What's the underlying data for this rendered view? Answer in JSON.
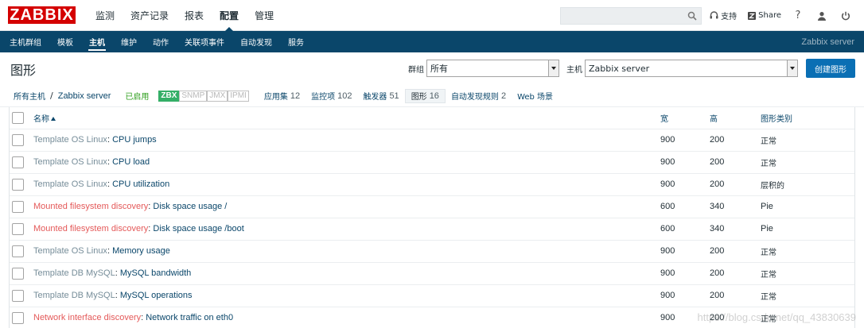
{
  "logo": "ZABBIX",
  "main_menu": [
    "监测",
    "资产记录",
    "报表",
    "配置",
    "管理"
  ],
  "main_menu_active": 3,
  "top_right": {
    "search_placeholder": "",
    "support_label": "支持",
    "share_label": "Share",
    "help_icon": "?",
    "user_icon": "user-icon",
    "logout_icon": "power-icon"
  },
  "sub_menu": [
    "主机群组",
    "模板",
    "主机",
    "维护",
    "动作",
    "关联项事件",
    "自动发现",
    "服务"
  ],
  "sub_menu_active": 2,
  "server_name": "Zabbix server",
  "page_title": "图形",
  "filter": {
    "group_label": "群组",
    "group_value": "所有",
    "host_label": "主机",
    "host_value": "Zabbix server",
    "create_button": "创建图形"
  },
  "breadcrumb": {
    "all_hosts": "所有主机",
    "separator": "/",
    "host": "Zabbix server",
    "enabled": "已启用"
  },
  "availability": [
    "ZBX",
    "SNMP",
    "JMX",
    "IPMI"
  ],
  "tabs": [
    {
      "label": "应用集",
      "count": "12"
    },
    {
      "label": "监控项",
      "count": "102"
    },
    {
      "label": "触发器",
      "count": "51"
    },
    {
      "label": "图形",
      "count": "16"
    },
    {
      "label": "自动发现规则",
      "count": "2"
    },
    {
      "label": "Web 场景",
      "count": ""
    }
  ],
  "tab_active": 3,
  "columns": {
    "name": "名称",
    "width": "宽",
    "height": "高",
    "type": "图形类别"
  },
  "rows": [
    {
      "host": "Template OS Linux",
      "discovery": false,
      "name": "CPU jumps",
      "width": "900",
      "height": "200",
      "type": "正常"
    },
    {
      "host": "Template OS Linux",
      "discovery": false,
      "name": "CPU load",
      "width": "900",
      "height": "200",
      "type": "正常"
    },
    {
      "host": "Template OS Linux",
      "discovery": false,
      "name": "CPU utilization",
      "width": "900",
      "height": "200",
      "type": "层积的"
    },
    {
      "host": "Mounted filesystem discovery",
      "discovery": true,
      "name": "Disk space usage /",
      "width": "600",
      "height": "340",
      "type": "Pie"
    },
    {
      "host": "Mounted filesystem discovery",
      "discovery": true,
      "name": "Disk space usage /boot",
      "width": "600",
      "height": "340",
      "type": "Pie"
    },
    {
      "host": "Template OS Linux",
      "discovery": false,
      "name": "Memory usage",
      "width": "900",
      "height": "200",
      "type": "正常"
    },
    {
      "host": "Template DB MySQL",
      "discovery": false,
      "name": "MySQL bandwidth",
      "width": "900",
      "height": "200",
      "type": "正常"
    },
    {
      "host": "Template DB MySQL",
      "discovery": false,
      "name": "MySQL operations",
      "width": "900",
      "height": "200",
      "type": "正常"
    },
    {
      "host": "Network interface discovery",
      "discovery": true,
      "name": "Network traffic on eth0",
      "width": "900",
      "height": "200",
      "type": "正常"
    }
  ],
  "watermark": "https://blog.csdn.net/qq_43830639"
}
